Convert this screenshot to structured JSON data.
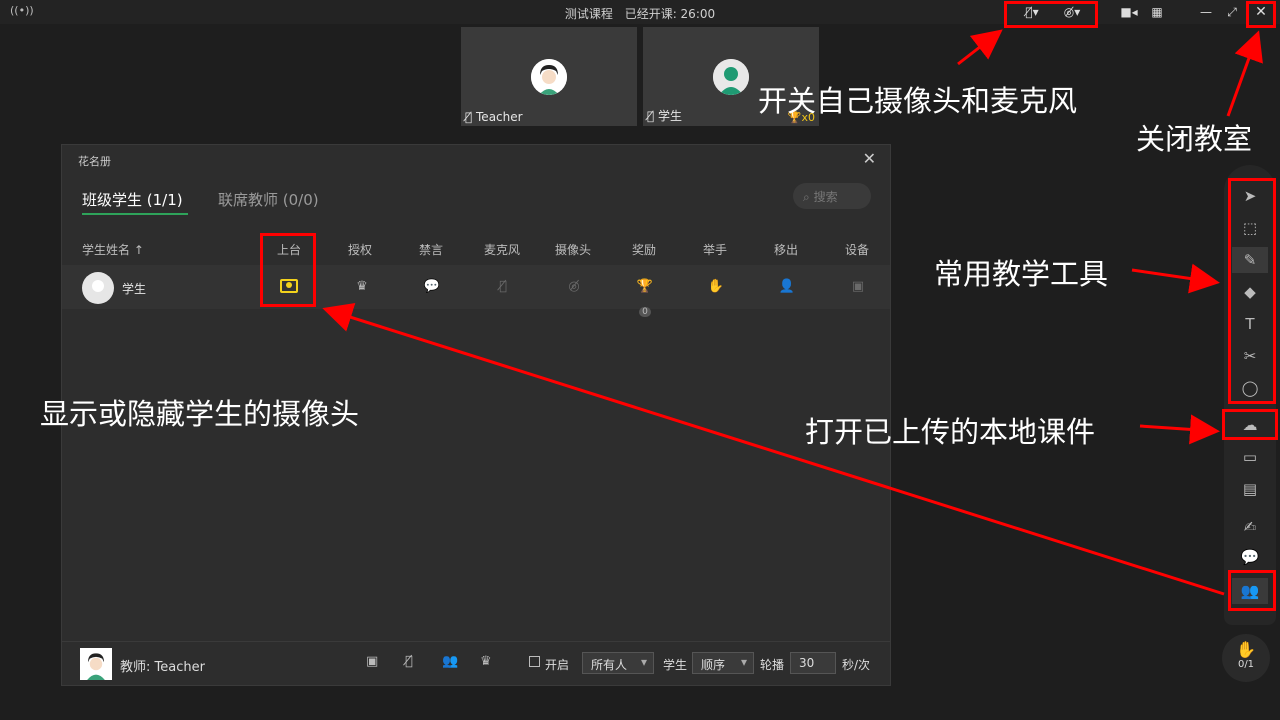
{
  "topbar": {
    "course_title": "测试课程",
    "elapsed_label": "已经开课: 26:00",
    "live_icon": "broadcast-icon",
    "mic_icon": "mic-off-icon",
    "camera_icon": "camera-off-icon",
    "video_icon": "video-icon",
    "grid_icon": "grid-icon",
    "minimize": "—",
    "maximize": "⤢",
    "close": "✕"
  },
  "tiles": [
    {
      "name": "Teacher",
      "trophy": ""
    },
    {
      "name": "学生",
      "trophy": "x0"
    }
  ],
  "roster": {
    "title": "花名册",
    "tabs": [
      {
        "label": "班级学生 (1/1)"
      },
      {
        "label": "联席教师 (0/0)"
      }
    ],
    "search_placeholder": "搜索",
    "columns": [
      "学生姓名 ↑",
      "上台",
      "授权",
      "禁言",
      "麦克风",
      "摄像头",
      "奖励",
      "举手",
      "移出",
      "设备"
    ],
    "students": [
      {
        "name": "学生",
        "reward_count": "0"
      }
    ],
    "footer": {
      "teacher_label": "教师: Teacher",
      "enable_label": "开启",
      "audience_select": "所有人",
      "student_label": "学生",
      "order_select": "顺序",
      "rotate_label": "轮播",
      "interval_value": "30",
      "unit_label": "秒/次"
    }
  },
  "toolbar": {
    "hand_count": "0/1"
  },
  "annotations": {
    "camera_mic": "开关自己摄像头和麦克风",
    "close_room": "关闭教室",
    "teaching_tools": "常用教学工具",
    "toggle_student_camera": "显示或隐藏学生的摄像头",
    "open_courseware": "打开已上传的本地课件"
  },
  "colors": {
    "accent": "#2ea35a",
    "annotation": "#ff0000",
    "stage": "#f3d21c"
  }
}
